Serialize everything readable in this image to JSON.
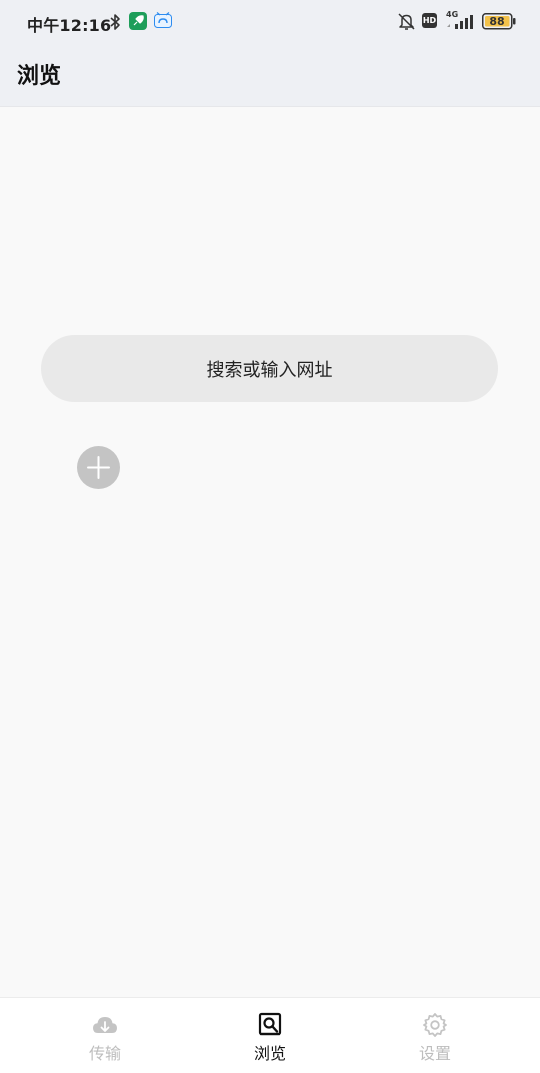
{
  "status_bar": {
    "time": "中午12:16",
    "hd_badge": "HD",
    "network": "4G",
    "battery": "88",
    "icons": [
      "bluetooth-icon",
      "rocket-app-icon",
      "cloud-app-icon",
      "bell-off-icon",
      "hd-icon",
      "signal-icon",
      "battery-icon"
    ]
  },
  "header": {
    "title": "浏览"
  },
  "main": {
    "search_placeholder": "搜索或输入网址",
    "add_icon": "plus-icon"
  },
  "bottom_nav": {
    "items": [
      {
        "label": "传输",
        "icon": "cloud-download-icon",
        "active": false
      },
      {
        "label": "浏览",
        "icon": "browse-search-icon",
        "active": true
      },
      {
        "label": "设置",
        "icon": "gear-icon",
        "active": false
      }
    ]
  },
  "colors": {
    "status_bar_bg": "#eef0f4",
    "content_bg": "#f9f9f9",
    "search_bg": "#e9e9e9",
    "add_button_bg": "#c4c4c4",
    "nav_inactive": "#bdbdbd",
    "nav_active": "#111111",
    "battery_fill": "#f3c24a",
    "app_green": "#1e9e5a",
    "app_blue": "#2d8cf0"
  }
}
